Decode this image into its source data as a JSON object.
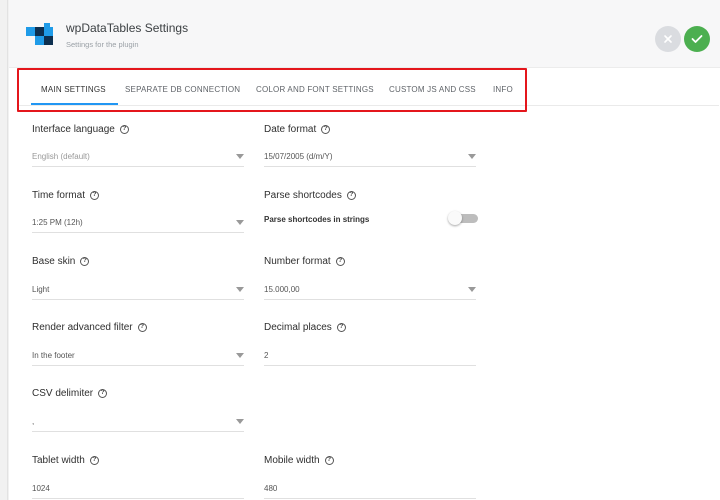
{
  "header": {
    "title": "wpDataTables Settings",
    "subtitle": "Settings for the plugin",
    "cancel_icon": "close-icon",
    "save_icon": "check-icon"
  },
  "tabs": [
    {
      "label": "MAIN SETTINGS",
      "active": true
    },
    {
      "label": "SEPARATE DB CONNECTION",
      "active": false
    },
    {
      "label": "COLOR AND FONT SETTINGS",
      "active": false
    },
    {
      "label": "CUSTOM JS AND CSS",
      "active": false
    },
    {
      "label": "INFO",
      "active": false
    }
  ],
  "fields": {
    "interface_language": {
      "label": "Interface language",
      "value": "English (default)"
    },
    "date_format": {
      "label": "Date format",
      "value": "15/07/2005 (d/m/Y)"
    },
    "time_format": {
      "label": "Time format",
      "value": "1:25 PM (12h)"
    },
    "parse_shortcodes": {
      "label": "Parse shortcodes",
      "toggle_label": "Parse shortcodes in strings",
      "enabled": false
    },
    "base_skin": {
      "label": "Base skin",
      "value": "Light"
    },
    "number_format": {
      "label": "Number format",
      "value": "15.000,00"
    },
    "render_advanced_filter": {
      "label": "Render advanced filter",
      "value": "In the footer"
    },
    "decimal_places": {
      "label": "Decimal places",
      "value": "2"
    },
    "csv_delimiter": {
      "label": "CSV delimiter",
      "value": ","
    },
    "tablet_width": {
      "label": "Tablet width",
      "value": "1024"
    },
    "mobile_width": {
      "label": "Mobile width",
      "value": "480"
    }
  },
  "help_glyph": "?",
  "colors": {
    "accent": "#2196f3",
    "save": "#4caf50",
    "highlight": "#e4161c"
  }
}
